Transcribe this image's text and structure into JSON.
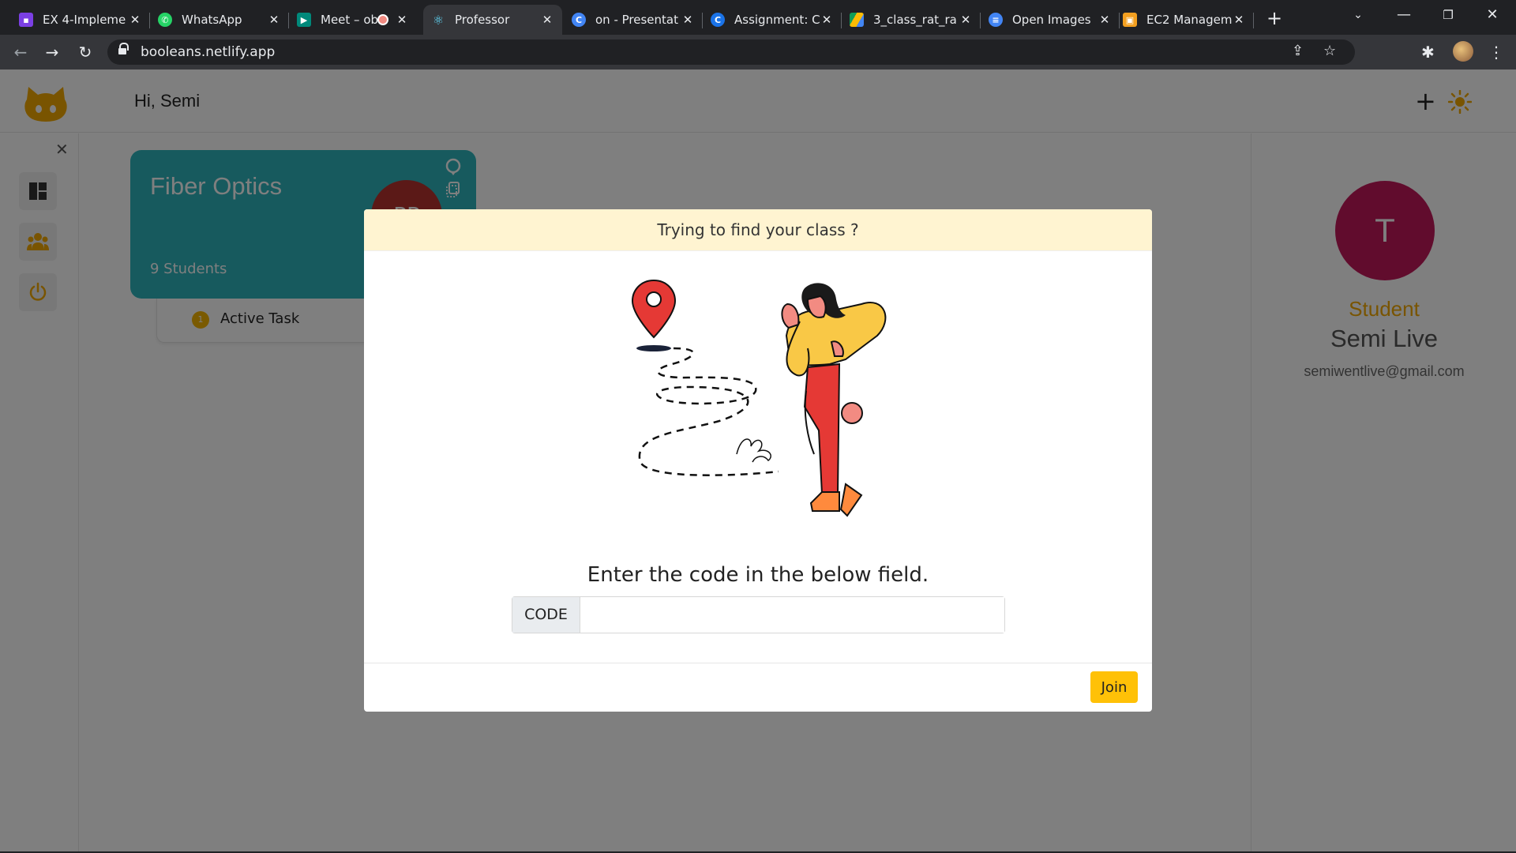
{
  "browser": {
    "tabs": [
      {
        "title": "EX 4-Impleme",
        "favicon_color": "#7b3fe4"
      },
      {
        "title": "WhatsApp",
        "favicon_color": "#25d366"
      },
      {
        "title": "Meet – ob",
        "favicon_color": "#00897b"
      },
      {
        "title": "Professor",
        "favicon_color": "#61dafb"
      },
      {
        "title": "on - Presentat",
        "favicon_color": "#4285f4"
      },
      {
        "title": "Assignment: C",
        "favicon_color": "#1a73e8"
      },
      {
        "title": "3_class_rat_ra",
        "favicon_color": "#fbbc04"
      },
      {
        "title": "Open Images",
        "favicon_color": "#4285f4"
      },
      {
        "title": "EC2 Managem",
        "favicon_color": "#f4a020"
      }
    ],
    "active_tab_index": 3,
    "url": "booleans.netlify.app"
  },
  "app": {
    "greeting": "Hi, Semi",
    "accent_color": "#f2a900"
  },
  "class_card": {
    "title": "Fiber Optics",
    "students": "9 Students",
    "avatar_initials": "PP",
    "task_number": "1",
    "task_label": "Active Task",
    "color": "#2fb4bd"
  },
  "profile": {
    "avatar_letter": "T",
    "role": "Student",
    "name": "Semi Live",
    "email": "semiwentlive@gmail.com",
    "avatar_color": "#c2185b"
  },
  "modal": {
    "header": "Trying to find your class ?",
    "prompt": "Enter the code in the below field.",
    "code_label": "CODE",
    "code_value": "",
    "join_label": "Join"
  }
}
